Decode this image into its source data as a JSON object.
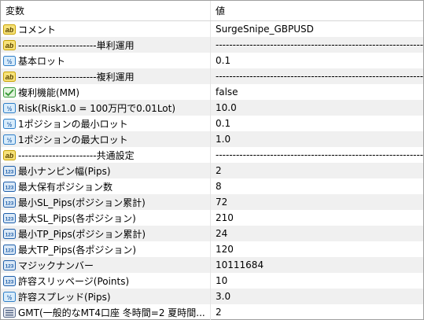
{
  "header": {
    "name_col": "変数",
    "value_col": "値"
  },
  "rows": [
    {
      "icon": "string-ab-icon",
      "name": "コメント",
      "value": "SurgeSnipe_GBPUSD"
    },
    {
      "icon": "string-ab-icon",
      "name": "-----------------------単利運用",
      "value": "--------------------------------------------------------------------"
    },
    {
      "icon": "double-v2-icon",
      "name": "基本ロット",
      "value": "0.1"
    },
    {
      "icon": "string-ab-icon",
      "name": "-----------------------複利運用",
      "value": "--------------------------------------------------------------------"
    },
    {
      "icon": "bool-check-icon",
      "name": "複利機能(MM)",
      "value": "false"
    },
    {
      "icon": "double-v2-icon",
      "name": "Risk(Risk1.0 = 100万円で0.01Lot)",
      "value": "10.0"
    },
    {
      "icon": "double-v2-icon",
      "name": "1ポジションの最小ロット",
      "value": "0.1"
    },
    {
      "icon": "double-v2-icon",
      "name": "1ポジションの最大ロット",
      "value": "1.0"
    },
    {
      "icon": "string-ab-icon",
      "name": "-----------------------共通設定",
      "value": "--------------------------------------------------------------------"
    },
    {
      "icon": "int-123-icon",
      "name": "最小ナンピン幅(Pips)",
      "value": "2"
    },
    {
      "icon": "int-123-icon",
      "name": "最大保有ポジション数",
      "value": "8"
    },
    {
      "icon": "int-123-icon",
      "name": "最小SL_Pips(ポジション累計)",
      "value": "72"
    },
    {
      "icon": "int-123-icon",
      "name": "最大SL_Pips(各ポジション)",
      "value": "210"
    },
    {
      "icon": "int-123-icon",
      "name": "最小TP_Pips(ポジション累計)",
      "value": "24"
    },
    {
      "icon": "int-123-icon",
      "name": "最大TP_Pips(各ポジション)",
      "value": "120"
    },
    {
      "icon": "int-123-icon",
      "name": "マジックナンバー",
      "value": "10111684"
    },
    {
      "icon": "int-123-icon",
      "name": "許容スリッページ(Points)",
      "value": "10"
    },
    {
      "icon": "double-v2-icon",
      "name": "許容スプレッド(Pips)",
      "value": "3.0"
    },
    {
      "icon": "enum-list-icon",
      "name": "GMT(一般的なMT4口座 冬時間=2 夏時間...",
      "value": "2"
    }
  ],
  "icon_colors": {
    "string": "#c8a200",
    "double": "#2f7fc8",
    "int": "#1f5faa",
    "bool": "#3a9a3a",
    "enum": "#5a6a8a"
  }
}
